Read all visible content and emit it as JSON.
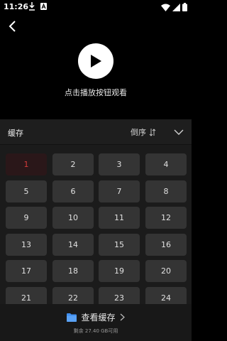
{
  "status_bar": {
    "time": "11:26",
    "icons": [
      "download-icon",
      "a-icon",
      "wifi-icon",
      "signal-icon",
      "battery-icon"
    ]
  },
  "player": {
    "back_icon": "back-arrow-icon",
    "play_icon": "play-icon",
    "hint": "点击播放按钮观看"
  },
  "panel": {
    "title": "缓存",
    "sort_label": "倒序",
    "sort_icon": "sort-icon",
    "collapse_icon": "chevron-down-icon",
    "episodes": [
      "1",
      "2",
      "3",
      "4",
      "5",
      "6",
      "7",
      "8",
      "9",
      "10",
      "11",
      "12",
      "13",
      "14",
      "15",
      "16",
      "17",
      "18",
      "19",
      "20",
      "21",
      "22",
      "23",
      "24"
    ],
    "active_episode": "1"
  },
  "footer": {
    "cache_label": "查看缓存",
    "folder_icon": "folder-icon",
    "chevron_icon": "chevron-right-icon",
    "storage": "剩余 27.40 GB可用"
  },
  "colors": {
    "background": "#000000",
    "panel": "#1b1b1b",
    "tile": "#343434",
    "active_text": "#d63a3a",
    "folder": "#3f8ef0"
  }
}
